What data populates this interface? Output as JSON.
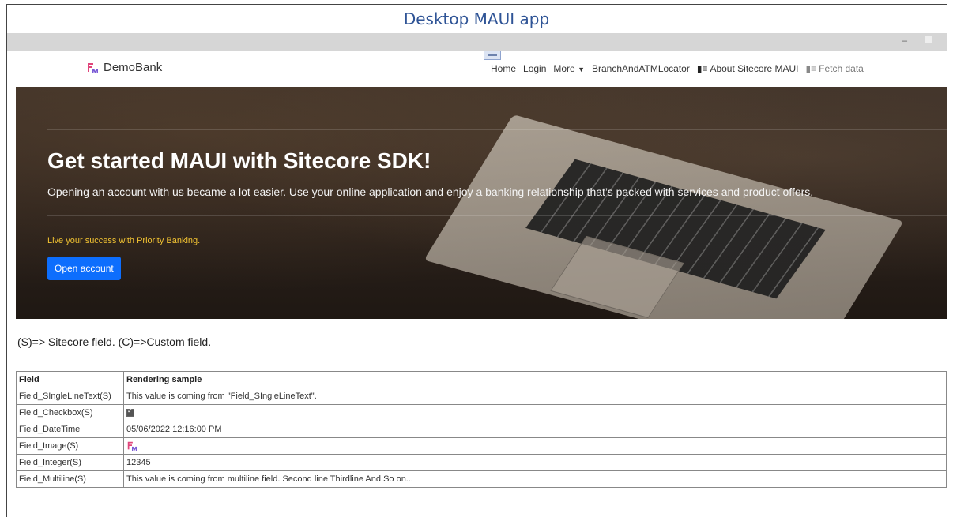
{
  "caption": "Desktop MAUI app",
  "window": {
    "minimize_glyph": "–",
    "maximize_glyph": ""
  },
  "navbar": {
    "brand": "DemoBank",
    "links": {
      "home": "Home",
      "login": "Login",
      "more": "More",
      "branch": "BranchAndATMLocator",
      "about": "About Sitecore MAUI",
      "fetch": "Fetch data"
    }
  },
  "hero": {
    "title": "Get started MAUI with Sitecore SDK!",
    "text": "Opening an account with us became a lot easier. Use your online application and enjoy a banking relationship that’s packed with services and product offers.",
    "tagline": "Live your success with Priority Banking.",
    "button": "Open account"
  },
  "content": {
    "legend": "(S)=> Sitecore field. (C)=>Custom field.",
    "table": {
      "headers": [
        "Field",
        "Rendering sample"
      ],
      "rows": [
        {
          "field": "Field_SIngleLineText(S)",
          "value": "This value is coming from \"Field_SIngleLineText\"."
        },
        {
          "field": "Field_Checkbox(S)",
          "value": "",
          "checked": true
        },
        {
          "field": "Field_DateTime",
          "value": "05/06/2022 12:16:00 PM"
        },
        {
          "field": "Field_Image(S)",
          "value": ""
        },
        {
          "field": "Field_Integer(S)",
          "value": "12345"
        },
        {
          "field": "Field_Multiline(S)",
          "value": "This value is coming from multiline field. Second line Thirdline And So on..."
        }
      ]
    }
  },
  "colors": {
    "caption": "#2f5496",
    "button": "#0d6efd",
    "tagline": "#f1c232",
    "logo_primary": "#e0457b",
    "logo_secondary": "#7b5cd6"
  }
}
